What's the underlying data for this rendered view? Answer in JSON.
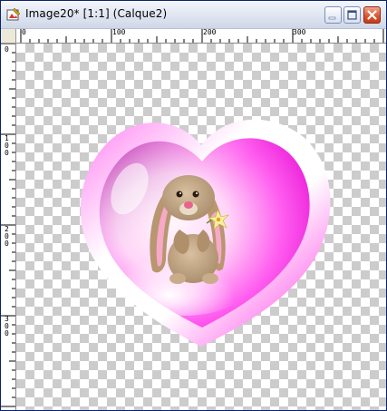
{
  "window": {
    "title": "Image20* [1:1] (Calque2)"
  },
  "titlebar_buttons": [
    {
      "name": "minimize",
      "icon": "minimize-icon"
    },
    {
      "name": "maximize",
      "icon": "maximize-icon"
    },
    {
      "name": "close",
      "icon": "close-icon"
    }
  ],
  "ruler": {
    "horizontal_labels": [
      "0",
      "100",
      "200",
      "300"
    ],
    "vertical_labels": [
      "0",
      "100",
      "200",
      "300"
    ]
  },
  "canvas": {
    "background": "transparency-checkerboard",
    "image": "pink-heart-with-bunny-holding-flower",
    "colors": {
      "heart_pink": "#ff33ee",
      "heart_light": "#ffe8fb",
      "border_white": "#ffffff",
      "bunny_tan": "#b89a78",
      "checker_gray": "#cccccc"
    }
  }
}
